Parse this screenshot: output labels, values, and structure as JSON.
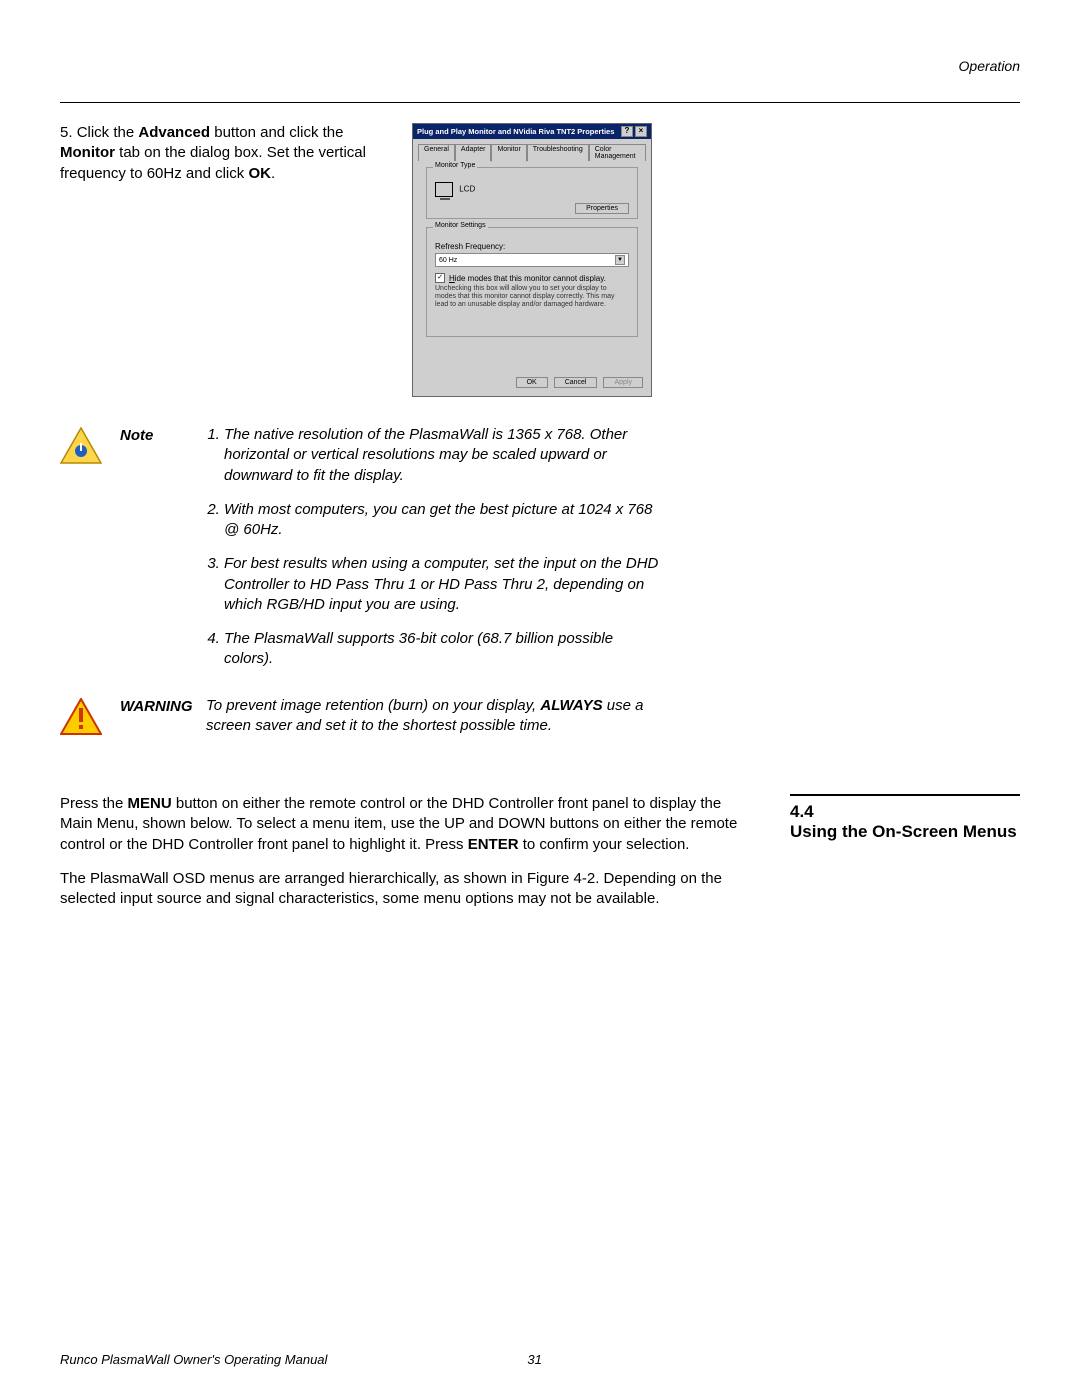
{
  "header": {
    "section_label": "Operation"
  },
  "step": {
    "number": "5.",
    "pre": "Click the ",
    "b1": "Advanced",
    "mid1": " button and click the ",
    "b2": "Monitor",
    "mid2": " tab on the dialog box. Set the vertical frequency to 60Hz and click ",
    "b3": "OK",
    "post": "."
  },
  "dialog": {
    "title": "Plug and Play Monitor and NVidia Riva TNT2 Properties",
    "help_glyph": "?",
    "close_glyph": "×",
    "tabs": [
      "General",
      "Adapter",
      "Monitor",
      "Troubleshooting",
      "Color Management"
    ],
    "active_tab_index": 2,
    "group_monitor_type": "Monitor Type",
    "monitor_type_value": "LCD",
    "properties_btn": "Properties",
    "group_monitor_settings": "Monitor Settings",
    "refresh_label": "Refresh Frequency:",
    "refresh_value": "60 Hz",
    "chk_glyph": "✓",
    "hide_modes_u": "H",
    "hide_modes_rest": "ide modes that this monitor cannot display.",
    "fine_print": "Unchecking this box will allow you to set your display to modes that this monitor cannot display correctly. This may lead to an unusable display and/or damaged hardware.",
    "ok_btn": "OK",
    "cancel_btn": "Cancel",
    "apply_btn": "Apply"
  },
  "note": {
    "label": "Note",
    "items": [
      "The native resolution of the PlasmaWall is 1365 x 768. Other horizontal or vertical resolutions may be scaled upward or downward to fit the display.",
      "With most computers, you can get the best picture at 1024 x 768 @ 60Hz.",
      "For best results when using a computer, set the input on the DHD Controller to HD Pass Thru 1 or HD Pass Thru 2, depending on which RGB/HD input you are using.",
      "The PlasmaWall supports 36-bit color (68.7 billion possible colors)."
    ]
  },
  "warning": {
    "label": "WARNING",
    "pre": "To prevent image retention (burn) on your display, ",
    "b1": "ALWAYS",
    "post": " use a screen saver and set it to the shortest possible time."
  },
  "section": {
    "p1_pre": "Press the ",
    "p1_b1": "MENU",
    "p1_mid": " button on either the remote control or the DHD Controller front panel to display the Main Menu, shown below. To select a menu item, use the UP and DOWN buttons on either the remote control or the DHD Controller front panel to highlight it. Press ",
    "p1_b2": "ENTER",
    "p1_post": " to confirm your selection.",
    "p2": "The PlasmaWall OSD menus are arranged hierarchically, as shown in Figure 4-2. Depending on the selected input source and signal characteristics, some menu options may not be available.",
    "number": "4.4",
    "title": "Using the On-Screen Menus"
  },
  "footer": {
    "manual": "Runco PlasmaWall Owner's Operating Manual",
    "page": "31"
  }
}
